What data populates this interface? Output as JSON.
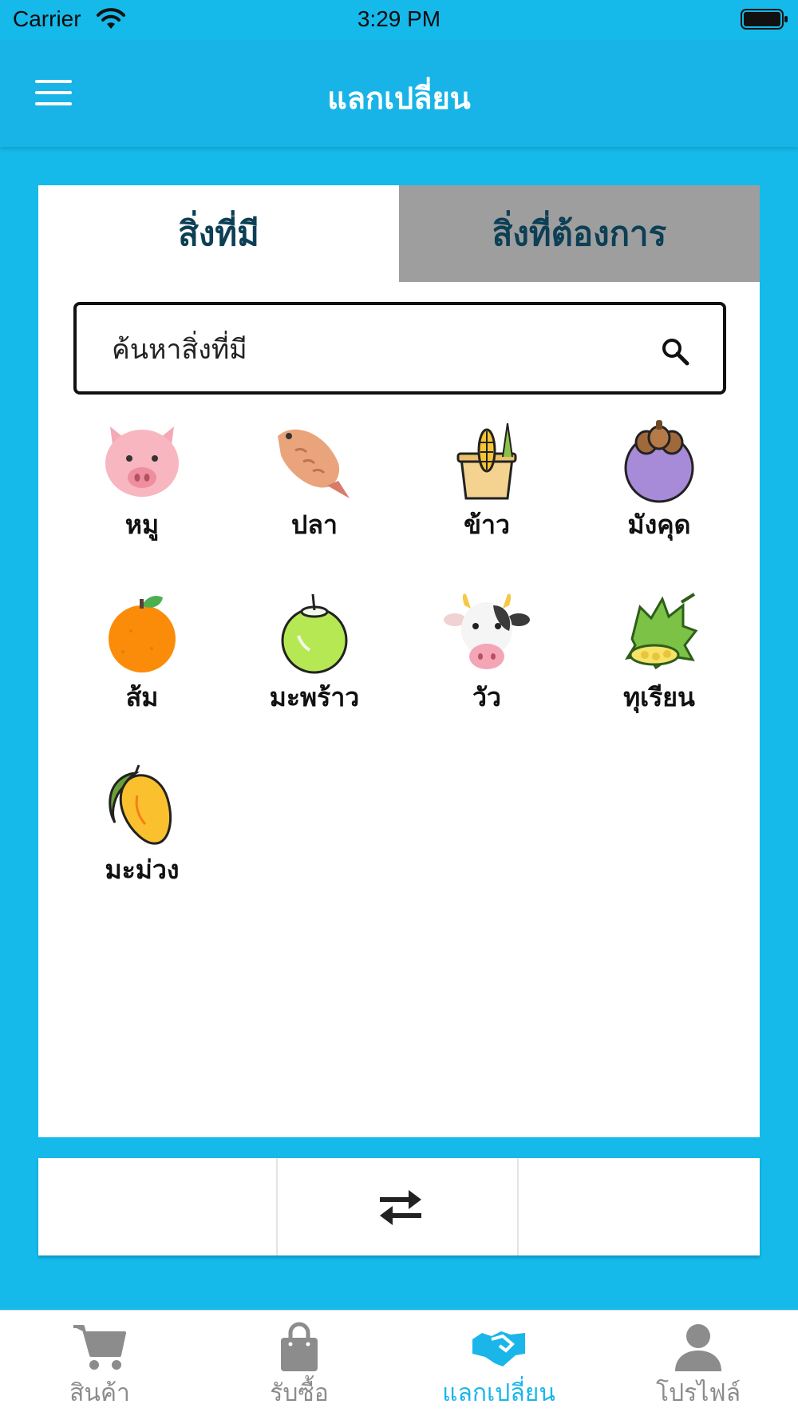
{
  "status_bar": {
    "carrier": "Carrier",
    "time": "3:29 PM"
  },
  "nav": {
    "title": "แลกเปลี่ยน"
  },
  "tabs": [
    {
      "label": "สิ่งที่มี",
      "active": true
    },
    {
      "label": "สิ่งที่ต้องการ",
      "active": false
    }
  ],
  "search": {
    "placeholder": "ค้นหาสิ่งที่มี"
  },
  "items": [
    {
      "label": "หมู",
      "icon": "pig-icon"
    },
    {
      "label": "ปลา",
      "icon": "fish-icon"
    },
    {
      "label": "ข้าว",
      "icon": "rice-icon"
    },
    {
      "label": "มังคุด",
      "icon": "mangosteen-icon"
    },
    {
      "label": "ส้ม",
      "icon": "orange-icon"
    },
    {
      "label": "มะพร้าว",
      "icon": "coconut-icon"
    },
    {
      "label": "วัว",
      "icon": "cow-icon"
    },
    {
      "label": "ทุเรียน",
      "icon": "durian-icon"
    },
    {
      "label": "มะม่วง",
      "icon": "mango-icon"
    }
  ],
  "exchange": {
    "icon": "exchange-arrows-icon"
  },
  "tab_bar": [
    {
      "label": "สินค้า",
      "icon": "cart-icon",
      "active": false
    },
    {
      "label": "รับซื้อ",
      "icon": "shopping-bag-icon",
      "active": false
    },
    {
      "label": "แลกเปลี่ยน",
      "icon": "handshake-icon",
      "active": true
    },
    {
      "label": "โปรไฟล์",
      "icon": "user-icon",
      "active": false
    }
  ],
  "colors": {
    "background": "#15b9ea",
    "nav": "#18b4e7",
    "tab_inactive": "#9e9e9e",
    "tab_text": "#0d3f55",
    "accent": "#1ab6ea",
    "inactive_gray": "#8c8c8c"
  }
}
